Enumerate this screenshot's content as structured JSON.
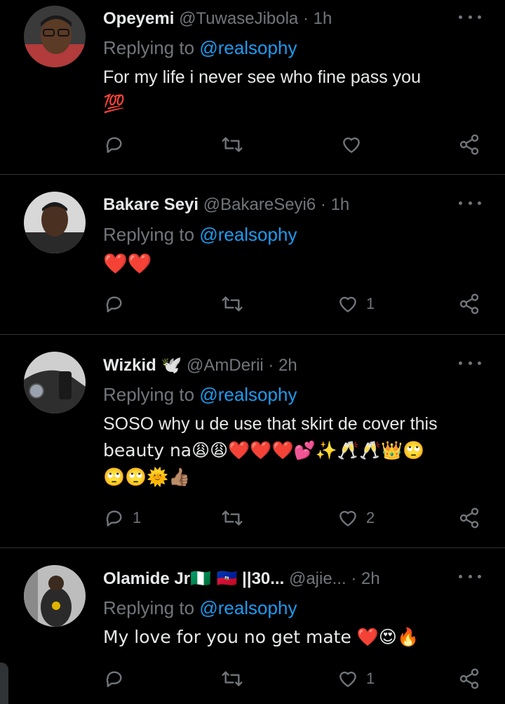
{
  "tweets": [
    {
      "name": "Opeyemi",
      "handle": "@TuwaseJibola",
      "time": "1h",
      "replying_prefix": "Replying to",
      "replying_to": "@realsophy",
      "text_line1": "For my life i never see who fine pass you",
      "text_line2": "💯",
      "reply_count": "",
      "retweet_count": "",
      "like_count": ""
    },
    {
      "name": "Bakare Seyi",
      "handle": "@BakareSeyi6",
      "time": "1h",
      "replying_prefix": "Replying to",
      "replying_to": "@realsophy",
      "text_line1": "❤️❤️",
      "reply_count": "",
      "retweet_count": "",
      "like_count": "1"
    },
    {
      "name": "Wizkid",
      "name_emoji": "🕊️",
      "handle": "@AmDerii",
      "time": "2h",
      "replying_prefix": "Replying to",
      "replying_to": "@realsophy",
      "text_line1": "SOSO why u de use that skirt de cover this",
      "text_line2": "beauty na😩😩❤️❤️❤️💕✨🥂🥂👑🙄",
      "text_line3": "🙄🙄🌞👍🏽",
      "reply_count": "1",
      "retweet_count": "",
      "like_count": "2"
    },
    {
      "name": "Olamide Jr",
      "name_emoji": "🇳🇬 🇭🇹",
      "name_suffix": "||30...",
      "handle": "@ajie...",
      "time": "2h",
      "replying_prefix": "Replying to",
      "replying_to": "@realsophy",
      "text_line1": "My love for you no get mate ❤️😍🔥",
      "reply_count": "",
      "retweet_count": "",
      "like_count": "1"
    }
  ],
  "icons": {
    "reply": "reply-icon",
    "retweet": "retweet-icon",
    "like": "heart-icon",
    "share": "share-icon",
    "more": "more-icon"
  },
  "colors": {
    "background": "#000000",
    "text": "#e7e9ea",
    "muted": "#71767b",
    "link": "#1d9bf0",
    "divider": "#2f3336"
  }
}
